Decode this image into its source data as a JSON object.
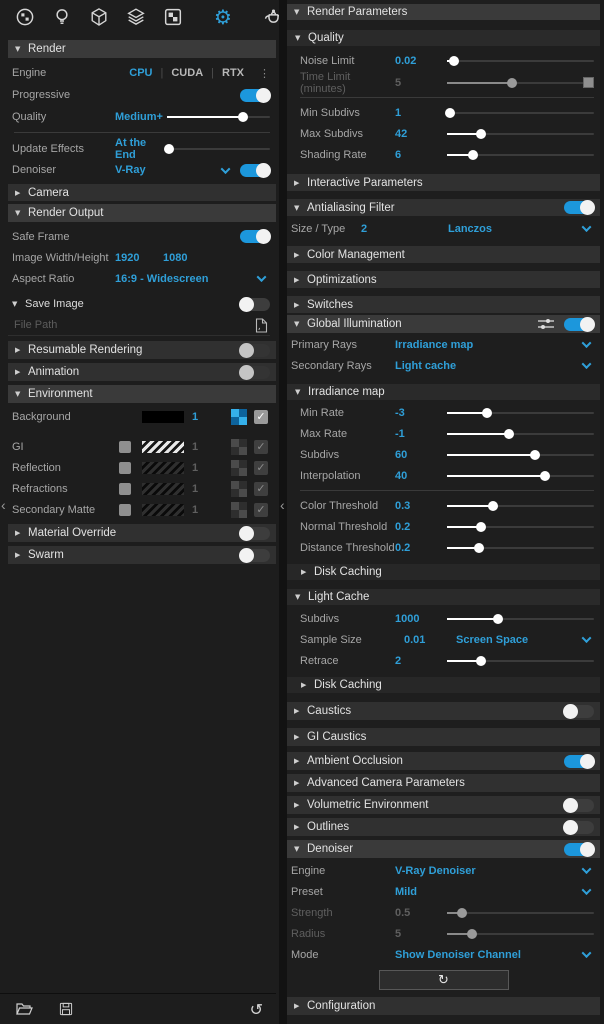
{
  "accent": "#2f9fd8",
  "icons": {
    "gear": "⚙",
    "check": "✓",
    "revert": "↺",
    "refresh": "↻",
    "kebab": "⋮",
    "caret_down": "▼",
    "caret_right": "▶",
    "chevron_left": "‹"
  },
  "toolbar": {
    "items": [
      "materials",
      "lights",
      "geometry",
      "layers",
      "textures",
      "settings",
      "render",
      "frame-buffer"
    ]
  },
  "left": {
    "render_header": "Render",
    "engine": {
      "label": "Engine",
      "options": [
        "CPU",
        "CUDA",
        "RTX"
      ],
      "selected": "CPU"
    },
    "progressive": {
      "label": "Progressive",
      "on": true
    },
    "quality": {
      "label": "Quality",
      "value": "Medium+",
      "pct": 74
    },
    "update_effects": {
      "label": "Update Effects",
      "value": "At the End",
      "pct": 2
    },
    "denoiser": {
      "label": "Denoiser",
      "value": "V-Ray",
      "on": true
    },
    "camera_header": "Camera",
    "render_output_header": "Render Output",
    "safe_frame": {
      "label": "Safe Frame",
      "on": true
    },
    "image_wh": {
      "label": "Image Width/Height",
      "width": "1920",
      "height": "1080"
    },
    "aspect": {
      "label": "Aspect Ratio",
      "value": "16:9 - Widescreen"
    },
    "save_image": {
      "label": "Save Image",
      "on": false
    },
    "file_path": {
      "placeholder": "File Path"
    },
    "resumable": {
      "label": "Resumable Rendering",
      "on": false
    },
    "animation": {
      "label": "Animation",
      "on": false
    },
    "environment_header": "Environment",
    "background": {
      "label": "Background",
      "value": "1"
    },
    "gi": {
      "label": "GI",
      "value": "1"
    },
    "reflection": {
      "label": "Reflection",
      "value": "1"
    },
    "refractions": {
      "label": "Refractions",
      "value": "1"
    },
    "secondary_matte": {
      "label": "Secondary Matte",
      "value": "1"
    },
    "material_override": {
      "label": "Material Override",
      "on": false
    },
    "swarm": {
      "label": "Swarm",
      "on": false
    }
  },
  "right": {
    "header": "Render Parameters",
    "quality_header": "Quality",
    "noise_limit": {
      "label": "Noise Limit",
      "value": "0.02",
      "pct": 5
    },
    "time_limit": {
      "label": "Time Limit (minutes)",
      "value": "5",
      "pct": 44
    },
    "min_subdivs": {
      "label": "Min Subdivs",
      "value": "1",
      "pct": 2
    },
    "max_subdivs": {
      "label": "Max Subdivs",
      "value": "42",
      "pct": 23
    },
    "shading_rate": {
      "label": "Shading Rate",
      "value": "6",
      "pct": 18
    },
    "interactive_header": "Interactive Parameters",
    "aa_filter": {
      "label": "Antialiasing Filter",
      "on": true
    },
    "size_type": {
      "label": "Size / Type",
      "value": "2",
      "dropdown": "Lanczos"
    },
    "color_mgmt_header": "Color Management",
    "optimizations_header": "Optimizations",
    "switches_header": "Switches",
    "gi_section": {
      "label": "Global Illumination",
      "on": true
    },
    "primary_rays": {
      "label": "Primary Rays",
      "value": "Irradiance map"
    },
    "secondary_rays": {
      "label": "Secondary Rays",
      "value": "Light cache"
    },
    "irradiance_header": "Irradiance map",
    "min_rate": {
      "label": "Min Rate",
      "value": "-3",
      "pct": 27
    },
    "max_rate": {
      "label": "Max Rate",
      "value": "-1",
      "pct": 42
    },
    "im_subdivs": {
      "label": "Subdivs",
      "value": "60",
      "pct": 60
    },
    "interpolation": {
      "label": "Interpolation",
      "value": "40",
      "pct": 67
    },
    "color_threshold": {
      "label": "Color Threshold",
      "value": "0.3",
      "pct": 31
    },
    "normal_threshold": {
      "label": "Normal Threshold",
      "value": "0.2",
      "pct": 23
    },
    "distance_threshold": {
      "label": "Distance Threshold",
      "value": "0.2",
      "pct": 22
    },
    "disk_caching_im": "Disk Caching",
    "light_cache_header": "Light Cache",
    "lc_subdivs": {
      "label": "Subdivs",
      "value": "1000",
      "pct": 35
    },
    "sample_size": {
      "label": "Sample Size",
      "value": "0.01",
      "dropdown": "Screen Space"
    },
    "retrace": {
      "label": "Retrace",
      "value": "2",
      "pct": 23
    },
    "disk_caching_lc": "Disk Caching",
    "caustics": {
      "label": "Caustics",
      "on": false
    },
    "gi_caustics": {
      "label": "GI Caustics"
    },
    "ambient_occlusion": {
      "label": "Ambient Occlusion",
      "on": true
    },
    "adv_camera": {
      "label": "Advanced Camera Parameters"
    },
    "volumetric": {
      "label": "Volumetric Environment",
      "on": false
    },
    "outlines": {
      "label": "Outlines",
      "on": false
    },
    "denoiser_section": {
      "label": "Denoiser",
      "on": true
    },
    "dn_engine": {
      "label": "Engine",
      "value": "V-Ray Denoiser"
    },
    "dn_preset": {
      "label": "Preset",
      "value": "Mild"
    },
    "dn_strength": {
      "label": "Strength",
      "value": "0.5",
      "pct": 10
    },
    "dn_radius": {
      "label": "Radius",
      "value": "5",
      "pct": 17
    },
    "dn_mode": {
      "label": "Mode",
      "value": "Show Denoiser Channel"
    },
    "configuration_header": "Configuration"
  }
}
